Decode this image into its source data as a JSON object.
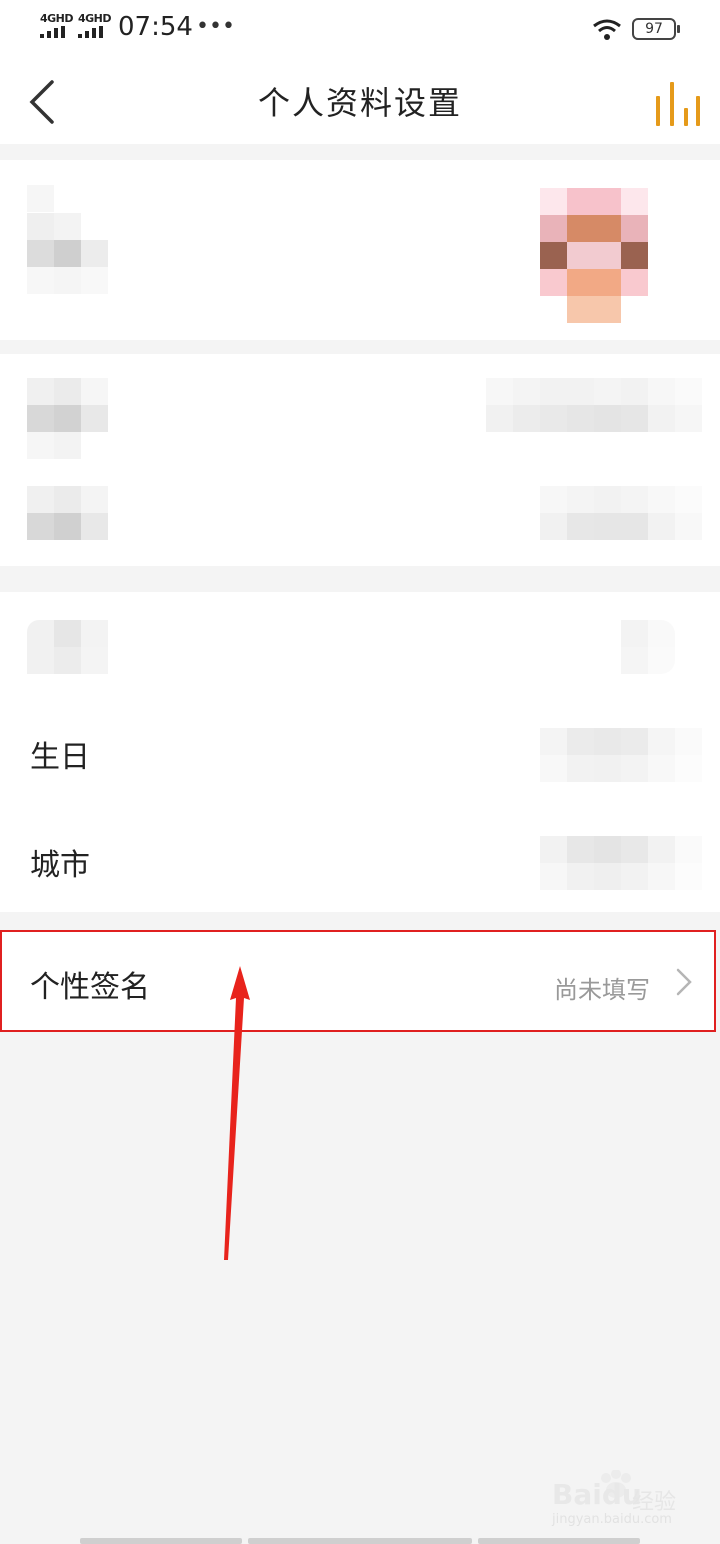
{
  "status_bar": {
    "sim1_label": "4GHD",
    "sim2_label": "4GHD",
    "time": "07:54",
    "more": "•••",
    "battery": "97"
  },
  "header": {
    "title": "个人资料设置"
  },
  "rows": {
    "birthday_label": "生日",
    "city_label": "城市",
    "signature_label": "个性签名",
    "signature_value": "尚未填写"
  },
  "watermark": {
    "brand": "Baidu",
    "brand_cn": "经验",
    "url": "jingyan.baidu.com"
  },
  "colors": {
    "accent": "#e59a1a",
    "highlight": "#e02020"
  }
}
